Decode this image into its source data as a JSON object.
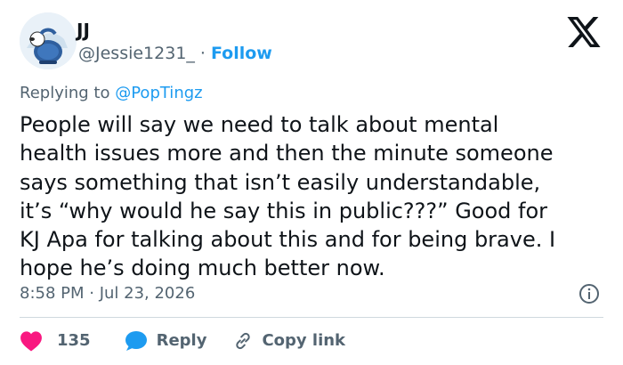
{
  "author": {
    "display_name": "JJ",
    "handle": "@Jessie1231_",
    "separator": "·",
    "follow_label": "Follow"
  },
  "reply_context": {
    "prefix": "Replying to",
    "mention": "@PopTingz"
  },
  "tweet": {
    "text": "People will say we need to talk about mental\nhealth issues more and then the minute someone\nsays something that isn’t easily understandable,\nit’s “why would he say this in public???” Good for\nKJ Apa for talking about this and for being brave. I\nhope he’s doing much better now.",
    "timestamp": "8:58 PM · Jul 23, 2026"
  },
  "actions": {
    "like_count": "135",
    "reply_label": "Reply",
    "copy_label": "Copy link"
  },
  "icons": {
    "logo": "x-logo-icon",
    "info": "info-icon",
    "like": "heart-icon",
    "reply": "speech-bubble-icon",
    "copy": "link-icon"
  },
  "colors": {
    "text": "#0f1419",
    "secondary": "#536471",
    "accent_blue": "#1d9bf0",
    "like_red": "#f91880",
    "divider": "#cfd9de"
  }
}
